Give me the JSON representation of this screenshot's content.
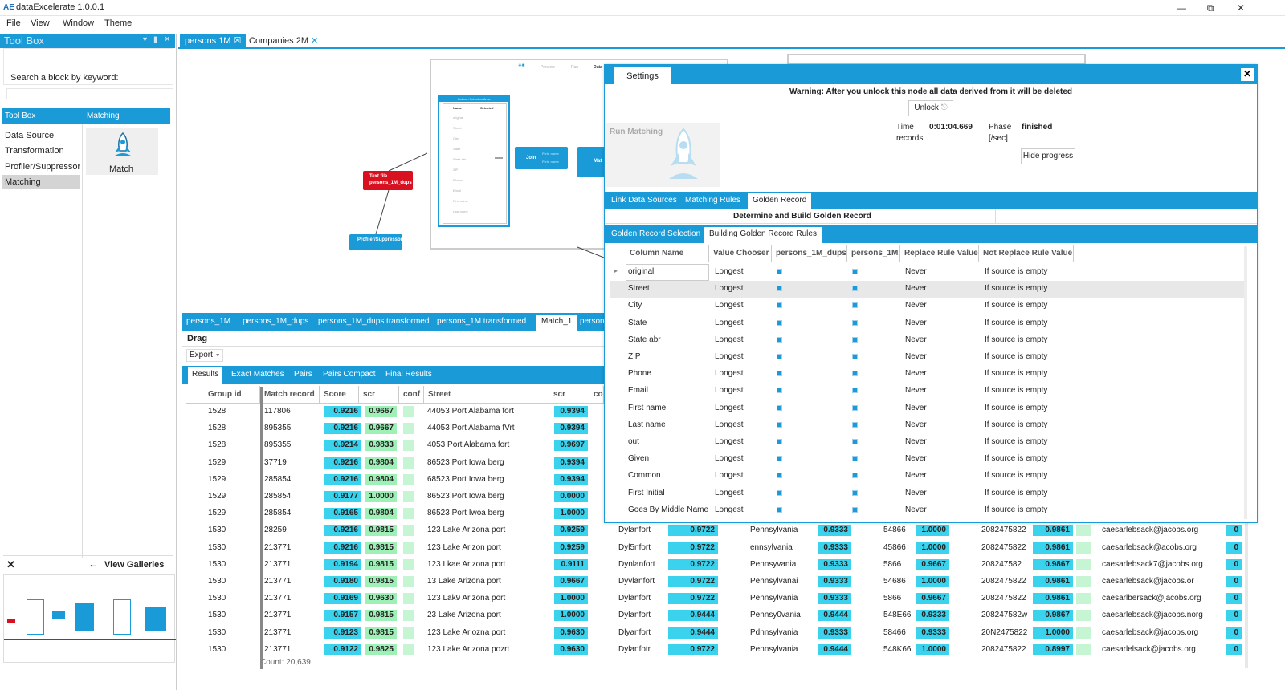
{
  "app": {
    "title": "dataExcelerate 1.0.0.1",
    "logo_text": "AE"
  },
  "menu": [
    "File",
    "View",
    "Window",
    "Theme"
  ],
  "toolbox": {
    "title": "Tool Box",
    "search_label": "Search a block by keyword:",
    "search_value": "",
    "tab1": "Tool Box",
    "tab2": "Matching",
    "categories": [
      "Data Source",
      "Transformation",
      "Profiler/Suppressor",
      "Matching"
    ],
    "selected_category": "Matching",
    "block_label": "Match",
    "view_galleries": "View Galleries"
  },
  "doc_tabs": [
    {
      "label": "persons 1M",
      "active": true
    },
    {
      "label": "Companies 2M",
      "active": false
    }
  ],
  "canvas": {
    "node_text_file": "Text file",
    "node_text_file_sub": "persons_1M_dups",
    "node_profiler": "Profiler/Suppressor",
    "node_join": "Join",
    "node_match": "Mat",
    "preview_labels": [
      "Preview",
      "Run",
      "Data"
    ],
    "column_area": {
      "title": "Column Selection Area",
      "col_name": "Name",
      "col_selected": "Selected",
      "items": [
        "original",
        "Street",
        "City",
        "State",
        "State abr",
        "ZIP",
        "Phone",
        "Email",
        "First name",
        "Last name"
      ]
    },
    "join_fields": [
      "Field name",
      "Field name"
    ]
  },
  "data_tabs": [
    "persons_1M",
    "persons_1M_dups",
    "persons_1M_dups transformed",
    "persons_1M transformed",
    "Match_1",
    "person"
  ],
  "active_data_tab": "Match_1",
  "drag_label": "Drag",
  "export_label": "Export",
  "result_tabs": [
    "Results",
    "Exact Matches",
    "Pairs",
    "Pairs Compact",
    "Final Results"
  ],
  "results": {
    "headers": [
      "Group id",
      "Match record",
      "Score",
      "scr",
      "conf",
      "Street",
      "scr",
      "co"
    ],
    "rows": [
      [
        "1528",
        "117806",
        "0.9216",
        "0.9667",
        "",
        "44053 Port Alabama fort",
        "0.9394",
        "",
        "",
        "",
        "",
        "",
        "",
        "",
        "",
        "",
        "",
        "",
        "",
        "",
        ""
      ],
      [
        "1528",
        "895355",
        "0.9216",
        "0.9667",
        "",
        "44053 Port Alabama fVrt",
        "0.9394",
        "",
        "",
        "",
        "",
        "",
        "",
        "",
        "",
        "",
        "",
        "",
        "",
        "",
        ""
      ],
      [
        "1528",
        "895355",
        "0.9214",
        "0.9833",
        "",
        "4053 Port Alabama fort",
        "0.9697",
        "",
        "",
        "",
        "",
        "",
        "",
        "",
        "",
        "",
        "",
        "",
        "",
        "",
        ""
      ],
      [
        "1529",
        "37719",
        "0.9216",
        "0.9804",
        "",
        "86523 Port Iowa berg",
        "0.9394",
        "",
        "",
        "",
        "",
        "",
        "",
        "",
        "",
        "",
        "",
        "",
        "",
        "",
        ""
      ],
      [
        "1529",
        "285854",
        "0.9216",
        "0.9804",
        "",
        "68523 Port Iowa berg",
        "0.9394",
        "",
        "",
        "",
        "",
        "",
        "",
        "",
        "",
        "",
        "",
        "",
        "",
        "",
        ""
      ],
      [
        "1529",
        "285854",
        "0.9177",
        "1.0000",
        "",
        "86523 Port Iowa berg",
        "0.0000",
        "",
        "",
        "",
        "",
        "",
        "",
        "",
        "",
        "",
        "",
        "",
        "",
        "",
        ""
      ],
      [
        "1529",
        "285854",
        "0.9165",
        "0.9804",
        "",
        "86523 Port Iwoa berg",
        "1.0000",
        "",
        "",
        "",
        "",
        "",
        "",
        "",
        "",
        "",
        "",
        "",
        "",
        "",
        ""
      ],
      [
        "1530",
        "28259",
        "0.9216",
        "0.9815",
        "",
        "123 Lake Arizona port",
        "0.9259",
        "Dylanfort",
        "0.9722",
        "Pennsylvania",
        "0.9333",
        "54866",
        "1.0000",
        "2082475822",
        "0.9861",
        "caesarlebsack@jacobs.org",
        "0"
      ],
      [
        "1530",
        "213771",
        "0.9216",
        "0.9815",
        "",
        "123 Lake Arizon port",
        "0.9259",
        "Dyl5nfort",
        "0.9722",
        "ennsylvania",
        "0.9333",
        "45866",
        "1.0000",
        "2082475822",
        "0.9861",
        "caesarlebsack@acobs.org",
        "0"
      ],
      [
        "1530",
        "213771",
        "0.9194",
        "0.9815",
        "",
        "123 Lkae Arizona port",
        "0.9111",
        "Dynlanfort",
        "0.9722",
        "Pennsyvania",
        "0.9333",
        "5866",
        "0.9667",
        "208247582",
        "0.9867",
        "caesarlebsack7@jacobs.org",
        "0"
      ],
      [
        "1530",
        "213771",
        "0.9180",
        "0.9815",
        "",
        "13 Lake Arizona port",
        "0.9667",
        "Dyvlanfort",
        "0.9722",
        "Pennsylvanai",
        "0.9333",
        "54686",
        "1.0000",
        "2082475822",
        "0.9861",
        "caesarlebsack@jacobs.or",
        "0"
      ],
      [
        "1530",
        "213771",
        "0.9169",
        "0.9630",
        "",
        "123 Lak9 Arizona port",
        "1.0000",
        "Dylanfort",
        "0.9722",
        "Pennsylvania",
        "0.9333",
        "5866",
        "0.9667",
        "2082475822",
        "0.9861",
        "caesarlbersack@jacobs.org",
        "0"
      ],
      [
        "1530",
        "213771",
        "0.9157",
        "0.9815",
        "",
        "23 Lake Arizona port",
        "1.0000",
        "Dylanfort",
        "0.9444",
        "Pennsy0vania",
        "0.9444",
        "548E66",
        "0.9333",
        "208247582w",
        "0.9867",
        "caesarlebsack@jacobs.norg",
        "0"
      ],
      [
        "1530",
        "213771",
        "0.9123",
        "0.9815",
        "",
        "123 Lake Ariozna port",
        "0.9630",
        "Dlyanfort",
        "0.9444",
        "Pdnnsylvania",
        "0.9333",
        "58466",
        "0.9333",
        "20N2475822",
        "1.0000",
        "caesarlebsack@jacobs.org",
        "0"
      ],
      [
        "1530",
        "213771",
        "0.9122",
        "0.9825",
        "",
        "123 Lake Arizona pozrt",
        "0.9630",
        "Dylanfotr",
        "0.9722",
        "Pennsylvania",
        "0.9444",
        "548K66",
        "1.0000",
        "2082475822",
        "0.8997",
        "caesarlelsack@jacobs.org",
        "0"
      ]
    ],
    "count": "Count: 20,639"
  },
  "settings": {
    "title": "Settings",
    "warning": "Warning: After you unlock this node all data derived from it will be deleted",
    "unlock": "Unlock",
    "time_label": "Time",
    "time_value": "0:01:04.669",
    "records_label": "records",
    "phase_label": "Phase",
    "phase_value": "finished",
    "per_sec_label": "[/sec]",
    "hide_progress": "Hide progress",
    "run_matching": "Run Matching",
    "tabs": [
      "Link Data Sources",
      "Matching Rules",
      "Golden Record"
    ],
    "active_tab": "Golden Record",
    "section_title": "Determine and Build Golden Record",
    "subtabs": [
      "Golden Record Selection",
      "Building Golden Record Rules"
    ],
    "active_subtab": "Building Golden Record Rules",
    "grid_headers": [
      "Column Name",
      "Value Chooser",
      "persons_1M_dups",
      "persons_1M",
      "Replace Rule Value",
      "Not Replace Rule Value"
    ],
    "grid_rows": [
      [
        "original",
        "Longest",
        "Never",
        "If source is empty"
      ],
      [
        "Street",
        "Longest",
        "Never",
        "If source is empty"
      ],
      [
        "City",
        "Longest",
        "Never",
        "If source is empty"
      ],
      [
        "State",
        "Longest",
        "Never",
        "If source is empty"
      ],
      [
        "State abr",
        "Longest",
        "Never",
        "If source is empty"
      ],
      [
        "ZIP",
        "Longest",
        "Never",
        "If source is empty"
      ],
      [
        "Phone",
        "Longest",
        "Never",
        "If source is empty"
      ],
      [
        "Email",
        "Longest",
        "Never",
        "If source is empty"
      ],
      [
        "First name",
        "Longest",
        "Never",
        "If source is empty"
      ],
      [
        "Last name",
        "Longest",
        "Never",
        "If source is empty"
      ],
      [
        "out",
        "Longest",
        "Never",
        "If source is empty"
      ],
      [
        "Given",
        "Longest",
        "Never",
        "If source is empty"
      ],
      [
        "Common",
        "Longest",
        "Never",
        "If source is empty"
      ],
      [
        "First Initial",
        "Longest",
        "Never",
        "If source is empty"
      ],
      [
        "Goes By Middle Name",
        "Longest",
        "Never",
        "If source is empty"
      ]
    ]
  },
  "colors": {
    "accent": "#1a9ad6",
    "score_blue": "#3ad2ec",
    "score_green": "#9ef0b7",
    "node_red": "#d8101f"
  }
}
